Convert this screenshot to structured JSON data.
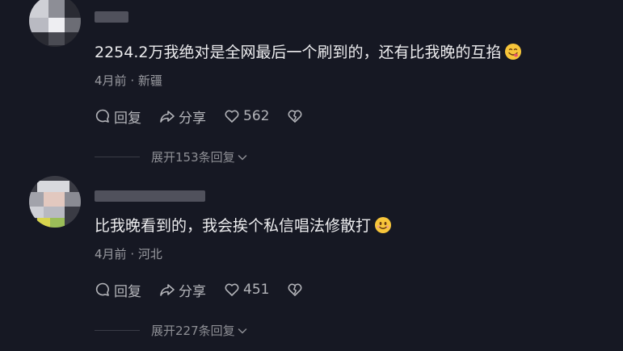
{
  "comments": [
    {
      "text": "2254.2万我绝对是全网最后一个刷到的，还有比我晚的互掐",
      "emoji": "yum-face-icon",
      "time": "4月前",
      "separator": "·",
      "location": "新疆",
      "reply_label": "回复",
      "share_label": "分享",
      "likes": "562",
      "expand_replies": "展开153条回复"
    },
    {
      "text": "比我晚看到的，我会挨个私信唱法修散打",
      "emoji": "smiling-face-icon",
      "time": "4月前",
      "separator": "·",
      "location": "河北",
      "reply_label": "回复",
      "share_label": "分享",
      "likes": "451",
      "expand_replies": "展开227条回复"
    }
  ],
  "colors": {
    "background": "#161823",
    "text": "#ececee",
    "meta": "#9a9ba1",
    "action": "#b4b5ba"
  }
}
